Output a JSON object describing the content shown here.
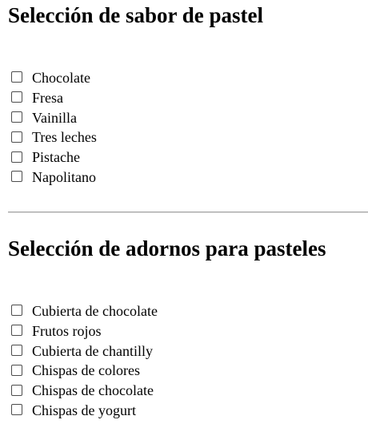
{
  "flavors": {
    "title": "Selección de sabor de pastel",
    "options": [
      {
        "label": "Chocolate",
        "checked": false
      },
      {
        "label": "Fresa",
        "checked": false
      },
      {
        "label": "Vainilla",
        "checked": false
      },
      {
        "label": "Tres leches",
        "checked": false
      },
      {
        "label": "Pistache",
        "checked": false
      },
      {
        "label": "Napolitano",
        "checked": false
      }
    ]
  },
  "toppings": {
    "title": "Selección de adornos para pasteles",
    "options": [
      {
        "label": "Cubierta de chocolate",
        "checked": false
      },
      {
        "label": "Frutos rojos",
        "checked": false
      },
      {
        "label": "Cubierta de chantilly",
        "checked": false
      },
      {
        "label": "Chispas de colores",
        "checked": false
      },
      {
        "label": "Chispas de chocolate",
        "checked": false
      },
      {
        "label": "Chispas de yogurt",
        "checked": false
      }
    ]
  }
}
